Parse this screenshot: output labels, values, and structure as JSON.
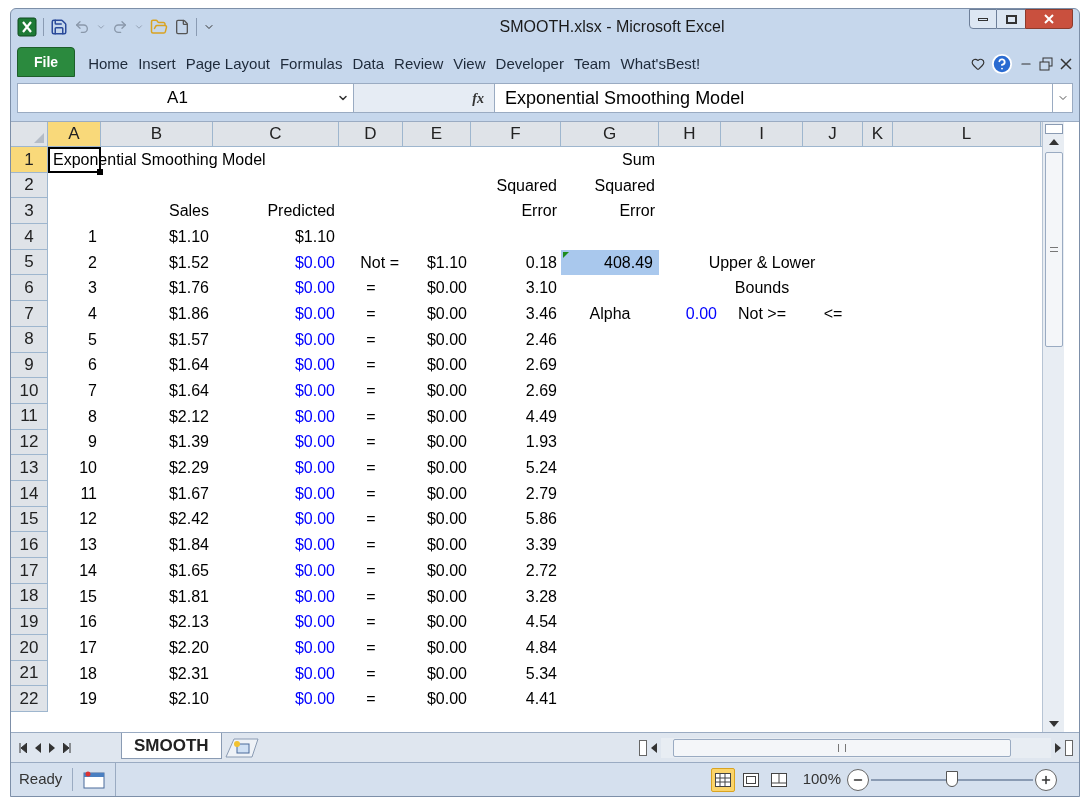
{
  "window": {
    "title": "SMOOTH.xlsx  -  Microsoft Excel"
  },
  "file_tab": {
    "label": "File"
  },
  "ribbon_tabs": [
    {
      "label": "Home",
      "selected": false
    },
    {
      "label": "Insert",
      "selected": false
    },
    {
      "label": "Page Layout",
      "selected": false
    },
    {
      "label": "Formulas",
      "selected": false
    },
    {
      "label": "Data",
      "selected": false
    },
    {
      "label": "Review",
      "selected": false
    },
    {
      "label": "View",
      "selected": false
    },
    {
      "label": "Developer",
      "selected": false
    },
    {
      "label": "Team",
      "selected": false
    },
    {
      "label": "What'sBest!",
      "selected": false
    }
  ],
  "formula_bar": {
    "name_box": "A1",
    "fx": "fx",
    "formula": "Exponential Smoothing Model"
  },
  "columns": [
    {
      "label": "A",
      "selected": true
    },
    {
      "label": "B",
      "selected": false
    },
    {
      "label": "C",
      "selected": false
    },
    {
      "label": "D",
      "selected": false
    },
    {
      "label": "E",
      "selected": false
    },
    {
      "label": "F",
      "selected": false
    },
    {
      "label": "G",
      "selected": false
    },
    {
      "label": "H",
      "selected": false
    },
    {
      "label": "I",
      "selected": false
    },
    {
      "label": "J",
      "selected": false
    },
    {
      "label": "K",
      "selected": false
    },
    {
      "label": "L",
      "selected": false
    }
  ],
  "rows": [
    {
      "label": "1",
      "selected": true,
      "cells": [
        {
          "text": "Exponential Smoothing Model",
          "kind": "text",
          "selected": true
        },
        null,
        null,
        null,
        null,
        null,
        {
          "text": "Sum",
          "kind": "number",
          "selected": false
        },
        null,
        null,
        null,
        null,
        null
      ]
    },
    {
      "label": "2",
      "selected": false,
      "cells": [
        null,
        null,
        null,
        null,
        null,
        {
          "text": "Squared",
          "kind": "number",
          "selected": false
        },
        {
          "text": "Squared",
          "kind": "number",
          "selected": false
        },
        null,
        null,
        null,
        null,
        null
      ]
    },
    {
      "label": "3",
      "selected": false,
      "cells": [
        null,
        {
          "text": "Sales",
          "kind": "number",
          "selected": false
        },
        {
          "text": "Predicted",
          "kind": "number",
          "selected": false
        },
        null,
        null,
        {
          "text": "Error",
          "kind": "number",
          "selected": false
        },
        {
          "text": "Error",
          "kind": "number",
          "selected": false
        },
        null,
        null,
        null,
        null,
        null
      ]
    },
    {
      "label": "4",
      "selected": false,
      "cells": [
        {
          "text": "1",
          "kind": "number",
          "selected": false
        },
        {
          "text": "$1.10",
          "kind": "number",
          "selected": false
        },
        {
          "text": "$1.10",
          "kind": "number",
          "selected": false
        },
        null,
        null,
        null,
        null,
        null,
        null,
        null,
        null,
        null
      ]
    },
    {
      "label": "5",
      "selected": false,
      "cells": [
        {
          "text": "2",
          "kind": "number",
          "selected": false
        },
        {
          "text": "$1.52",
          "kind": "number",
          "selected": false
        },
        {
          "text": "$0.00",
          "kind": "input",
          "selected": false
        },
        {
          "text": "Not =",
          "kind": "number",
          "selected": false
        },
        {
          "text": "$1.10",
          "kind": "number",
          "selected": false
        },
        {
          "text": "0.18",
          "kind": "number",
          "selected": false
        },
        {
          "text": "408.49",
          "kind": "flagged",
          "selected": false
        },
        null,
        {
          "text": "Upper & Lower",
          "kind": "centered",
          "selected": false
        },
        null,
        null,
        null
      ]
    },
    {
      "label": "6",
      "selected": false,
      "cells": [
        {
          "text": "3",
          "kind": "number",
          "selected": false
        },
        {
          "text": "$1.76",
          "kind": "number",
          "selected": false
        },
        {
          "text": "$0.00",
          "kind": "input",
          "selected": false
        },
        {
          "text": "=",
          "kind": "centered",
          "selected": false
        },
        {
          "text": "$0.00",
          "kind": "number",
          "selected": false
        },
        {
          "text": "3.10",
          "kind": "number",
          "selected": false
        },
        null,
        null,
        {
          "text": "Bounds",
          "kind": "centered",
          "selected": false
        },
        null,
        null,
        null
      ]
    },
    {
      "label": "7",
      "selected": false,
      "cells": [
        {
          "text": "4",
          "kind": "number",
          "selected": false
        },
        {
          "text": "$1.86",
          "kind": "number",
          "selected": false
        },
        {
          "text": "$0.00",
          "kind": "input",
          "selected": false
        },
        {
          "text": "=",
          "kind": "centered",
          "selected": false
        },
        {
          "text": "$0.00",
          "kind": "number",
          "selected": false
        },
        {
          "text": "3.46",
          "kind": "number",
          "selected": false
        },
        {
          "text": "Alpha",
          "kind": "centered",
          "selected": false
        },
        {
          "text": "0.00",
          "kind": "input",
          "selected": false
        },
        {
          "text": "Not >=",
          "kind": "centered",
          "selected": false
        },
        {
          "text": "<=",
          "kind": "centered",
          "selected": false
        },
        null,
        null
      ]
    },
    {
      "label": "8",
      "selected": false,
      "cells": [
        {
          "text": "5",
          "kind": "number",
          "selected": false
        },
        {
          "text": "$1.57",
          "kind": "number",
          "selected": false
        },
        {
          "text": "$0.00",
          "kind": "input",
          "selected": false
        },
        {
          "text": "=",
          "kind": "centered",
          "selected": false
        },
        {
          "text": "$0.00",
          "kind": "number",
          "selected": false
        },
        {
          "text": "2.46",
          "kind": "number",
          "selected": false
        },
        null,
        null,
        null,
        null,
        null,
        null
      ]
    },
    {
      "label": "9",
      "selected": false,
      "cells": [
        {
          "text": "6",
          "kind": "number",
          "selected": false
        },
        {
          "text": "$1.64",
          "kind": "number",
          "selected": false
        },
        {
          "text": "$0.00",
          "kind": "input",
          "selected": false
        },
        {
          "text": "=",
          "kind": "centered",
          "selected": false
        },
        {
          "text": "$0.00",
          "kind": "number",
          "selected": false
        },
        {
          "text": "2.69",
          "kind": "number",
          "selected": false
        },
        null,
        null,
        null,
        null,
        null,
        null
      ]
    },
    {
      "label": "10",
      "selected": false,
      "cells": [
        {
          "text": "7",
          "kind": "number",
          "selected": false
        },
        {
          "text": "$1.64",
          "kind": "number",
          "selected": false
        },
        {
          "text": "$0.00",
          "kind": "input",
          "selected": false
        },
        {
          "text": "=",
          "kind": "centered",
          "selected": false
        },
        {
          "text": "$0.00",
          "kind": "number",
          "selected": false
        },
        {
          "text": "2.69",
          "kind": "number",
          "selected": false
        },
        null,
        null,
        null,
        null,
        null,
        null
      ]
    },
    {
      "label": "11",
      "selected": false,
      "cells": [
        {
          "text": "8",
          "kind": "number",
          "selected": false
        },
        {
          "text": "$2.12",
          "kind": "number",
          "selected": false
        },
        {
          "text": "$0.00",
          "kind": "input",
          "selected": false
        },
        {
          "text": "=",
          "kind": "centered",
          "selected": false
        },
        {
          "text": "$0.00",
          "kind": "number",
          "selected": false
        },
        {
          "text": "4.49",
          "kind": "number",
          "selected": false
        },
        null,
        null,
        null,
        null,
        null,
        null
      ]
    },
    {
      "label": "12",
      "selected": false,
      "cells": [
        {
          "text": "9",
          "kind": "number",
          "selected": false
        },
        {
          "text": "$1.39",
          "kind": "number",
          "selected": false
        },
        {
          "text": "$0.00",
          "kind": "input",
          "selected": false
        },
        {
          "text": "=",
          "kind": "centered",
          "selected": false
        },
        {
          "text": "$0.00",
          "kind": "number",
          "selected": false
        },
        {
          "text": "1.93",
          "kind": "number",
          "selected": false
        },
        null,
        null,
        null,
        null,
        null,
        null
      ]
    },
    {
      "label": "13",
      "selected": false,
      "cells": [
        {
          "text": "10",
          "kind": "number",
          "selected": false
        },
        {
          "text": "$2.29",
          "kind": "number",
          "selected": false
        },
        {
          "text": "$0.00",
          "kind": "input",
          "selected": false
        },
        {
          "text": "=",
          "kind": "centered",
          "selected": false
        },
        {
          "text": "$0.00",
          "kind": "number",
          "selected": false
        },
        {
          "text": "5.24",
          "kind": "number",
          "selected": false
        },
        null,
        null,
        null,
        null,
        null,
        null
      ]
    },
    {
      "label": "14",
      "selected": false,
      "cells": [
        {
          "text": "11",
          "kind": "number",
          "selected": false
        },
        {
          "text": "$1.67",
          "kind": "number",
          "selected": false
        },
        {
          "text": "$0.00",
          "kind": "input",
          "selected": false
        },
        {
          "text": "=",
          "kind": "centered",
          "selected": false
        },
        {
          "text": "$0.00",
          "kind": "number",
          "selected": false
        },
        {
          "text": "2.79",
          "kind": "number",
          "selected": false
        },
        null,
        null,
        null,
        null,
        null,
        null
      ]
    },
    {
      "label": "15",
      "selected": false,
      "cells": [
        {
          "text": "12",
          "kind": "number",
          "selected": false
        },
        {
          "text": "$2.42",
          "kind": "number",
          "selected": false
        },
        {
          "text": "$0.00",
          "kind": "input",
          "selected": false
        },
        {
          "text": "=",
          "kind": "centered",
          "selected": false
        },
        {
          "text": "$0.00",
          "kind": "number",
          "selected": false
        },
        {
          "text": "5.86",
          "kind": "number",
          "selected": false
        },
        null,
        null,
        null,
        null,
        null,
        null
      ]
    },
    {
      "label": "16",
      "selected": false,
      "cells": [
        {
          "text": "13",
          "kind": "number",
          "selected": false
        },
        {
          "text": "$1.84",
          "kind": "number",
          "selected": false
        },
        {
          "text": "$0.00",
          "kind": "input",
          "selected": false
        },
        {
          "text": "=",
          "kind": "centered",
          "selected": false
        },
        {
          "text": "$0.00",
          "kind": "number",
          "selected": false
        },
        {
          "text": "3.39",
          "kind": "number",
          "selected": false
        },
        null,
        null,
        null,
        null,
        null,
        null
      ]
    },
    {
      "label": "17",
      "selected": false,
      "cells": [
        {
          "text": "14",
          "kind": "number",
          "selected": false
        },
        {
          "text": "$1.65",
          "kind": "number",
          "selected": false
        },
        {
          "text": "$0.00",
          "kind": "input",
          "selected": false
        },
        {
          "text": "=",
          "kind": "centered",
          "selected": false
        },
        {
          "text": "$0.00",
          "kind": "number",
          "selected": false
        },
        {
          "text": "2.72",
          "kind": "number",
          "selected": false
        },
        null,
        null,
        null,
        null,
        null,
        null
      ]
    },
    {
      "label": "18",
      "selected": false,
      "cells": [
        {
          "text": "15",
          "kind": "number",
          "selected": false
        },
        {
          "text": "$1.81",
          "kind": "number",
          "selected": false
        },
        {
          "text": "$0.00",
          "kind": "input",
          "selected": false
        },
        {
          "text": "=",
          "kind": "centered",
          "selected": false
        },
        {
          "text": "$0.00",
          "kind": "number",
          "selected": false
        },
        {
          "text": "3.28",
          "kind": "number",
          "selected": false
        },
        null,
        null,
        null,
        null,
        null,
        null
      ]
    },
    {
      "label": "19",
      "selected": false,
      "cells": [
        {
          "text": "16",
          "kind": "number",
          "selected": false
        },
        {
          "text": "$2.13",
          "kind": "number",
          "selected": false
        },
        {
          "text": "$0.00",
          "kind": "input",
          "selected": false
        },
        {
          "text": "=",
          "kind": "centered",
          "selected": false
        },
        {
          "text": "$0.00",
          "kind": "number",
          "selected": false
        },
        {
          "text": "4.54",
          "kind": "number",
          "selected": false
        },
        null,
        null,
        null,
        null,
        null,
        null
      ]
    },
    {
      "label": "20",
      "selected": false,
      "cells": [
        {
          "text": "17",
          "kind": "number",
          "selected": false
        },
        {
          "text": "$2.20",
          "kind": "number",
          "selected": false
        },
        {
          "text": "$0.00",
          "kind": "input",
          "selected": false
        },
        {
          "text": "=",
          "kind": "centered",
          "selected": false
        },
        {
          "text": "$0.00",
          "kind": "number",
          "selected": false
        },
        {
          "text": "4.84",
          "kind": "number",
          "selected": false
        },
        null,
        null,
        null,
        null,
        null,
        null
      ]
    },
    {
      "label": "21",
      "selected": false,
      "cells": [
        {
          "text": "18",
          "kind": "number",
          "selected": false
        },
        {
          "text": "$2.31",
          "kind": "number",
          "selected": false
        },
        {
          "text": "$0.00",
          "kind": "input",
          "selected": false
        },
        {
          "text": "=",
          "kind": "centered",
          "selected": false
        },
        {
          "text": "$0.00",
          "kind": "number",
          "selected": false
        },
        {
          "text": "5.34",
          "kind": "number",
          "selected": false
        },
        null,
        null,
        null,
        null,
        null,
        null
      ]
    },
    {
      "label": "22",
      "selected": false,
      "cells": [
        {
          "text": "19",
          "kind": "number",
          "selected": false
        },
        {
          "text": "$2.10",
          "kind": "number",
          "selected": false
        },
        {
          "text": "$0.00",
          "kind": "input",
          "selected": false
        },
        {
          "text": "=",
          "kind": "centered",
          "selected": false
        },
        {
          "text": "$0.00",
          "kind": "number",
          "selected": false
        },
        {
          "text": "4.41",
          "kind": "number",
          "selected": false
        },
        null,
        null,
        null,
        null,
        null,
        null
      ]
    }
  ],
  "sheet_tabs": [
    {
      "label": "SMOOTH",
      "selected": true
    }
  ],
  "status_bar": {
    "status": "Ready",
    "views": [
      {
        "kind": "normal",
        "selected": true
      },
      {
        "kind": "page-layout",
        "selected": false
      },
      {
        "kind": "page-break",
        "selected": false
      }
    ],
    "zoom": "100%",
    "zoom_slider": {
      "level": 0.5
    }
  }
}
